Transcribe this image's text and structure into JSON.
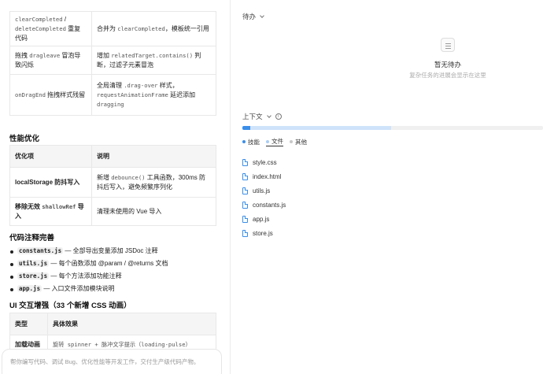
{
  "table1": {
    "rows": [
      {
        "c1_parts": [
          {
            "t": "clearCompleted",
            "code": true
          },
          {
            "t": " / ",
            "code": false
          },
          {
            "t": "deleteCompleted",
            "code": true
          },
          {
            "t": " 重复代码",
            "code": false
          }
        ],
        "c2_parts": [
          {
            "t": "合并为 ",
            "code": false
          },
          {
            "t": "clearCompleted",
            "code": true
          },
          {
            "t": "，模板统一引用",
            "code": false
          }
        ]
      },
      {
        "c1_parts": [
          {
            "t": "拖拽 ",
            "code": false
          },
          {
            "t": "dragleave",
            "code": true
          },
          {
            "t": " 冒泡导致闪烁",
            "code": false
          }
        ],
        "c2_parts": [
          {
            "t": "增加 ",
            "code": false
          },
          {
            "t": "relatedTarget.contains()",
            "code": true
          },
          {
            "t": " 判断，过滤子元素冒泡",
            "code": false
          }
        ]
      },
      {
        "c1_parts": [
          {
            "t": "onDragEnd",
            "code": true
          },
          {
            "t": " 拖拽样式残留",
            "code": false
          }
        ],
        "c2_parts": [
          {
            "t": "全局清理 ",
            "code": false
          },
          {
            "t": ".drag-over",
            "code": true
          },
          {
            "t": " 样式，",
            "code": false
          },
          {
            "t": "requestAnimationFrame",
            "code": true
          },
          {
            "t": " 延迟添加 ",
            "code": false
          },
          {
            "t": "dragging",
            "code": true
          }
        ]
      }
    ]
  },
  "perf": {
    "heading": "性能优化",
    "headers": [
      "优化项",
      "说明"
    ],
    "rows": [
      {
        "c1_parts": [
          {
            "t": "localStorage 防抖写入",
            "code": false
          }
        ],
        "c2_parts": [
          {
            "t": "新增 ",
            "code": false
          },
          {
            "t": "debounce()",
            "code": true
          },
          {
            "t": " 工具函数，300ms 防抖后写入，避免频繁序列化",
            "code": false
          }
        ]
      },
      {
        "c1_parts": [
          {
            "t": "移除无效 ",
            "code": false
          },
          {
            "t": "shallowRef",
            "code": true
          },
          {
            "t": " 导入",
            "code": false
          }
        ],
        "c2_parts": [
          {
            "t": "清理未使用的 Vue 导入",
            "code": false
          }
        ]
      }
    ]
  },
  "comments": {
    "heading": "代码注释完善",
    "items": [
      {
        "file": "constants.js",
        "text": " — 全部导出变量添加 JSDoc 注释"
      },
      {
        "file": "utils.js",
        "text": " — 每个函数添加 @param / @returns 文档"
      },
      {
        "file": "store.js",
        "text": " — 每个方法添加功能注释"
      },
      {
        "file": "app.js",
        "text": " — 入口文件添加模块说明"
      }
    ]
  },
  "ui": {
    "heading": "UI 交互增强（33 个新增 CSS 动画）",
    "headers": [
      "类型",
      "具体效果"
    ],
    "partial_row": {
      "c1": "加载动画",
      "c2": "旋转 spinner + 脉冲文字提示（loading-pulse）"
    }
  },
  "composer": {
    "placeholder": "帮你编写代码、调试 Bug、优化性能等开发工作，交付生产级代码产物。"
  },
  "right": {
    "todo_title": "待办",
    "empty_title": "暂无待办",
    "empty_subtitle": "复杂任务的进展会显示在这里",
    "context_title": "上下文",
    "context_segments": [
      {
        "name": "技能",
        "fraction": 0.025,
        "color": "#3b8ee8"
      },
      {
        "name": "文件",
        "fraction": 0.47,
        "color": "#cfe3fa"
      }
    ],
    "legend": [
      {
        "label": "技能",
        "color": "#3b8ee8"
      },
      {
        "label": "文件",
        "color": "#a9cdf5"
      },
      {
        "label": "其他",
        "color": "#c8c8c8"
      }
    ],
    "files": [
      "style.css",
      "index.html",
      "utils.js",
      "constants.js",
      "app.js",
      "store.js"
    ]
  }
}
